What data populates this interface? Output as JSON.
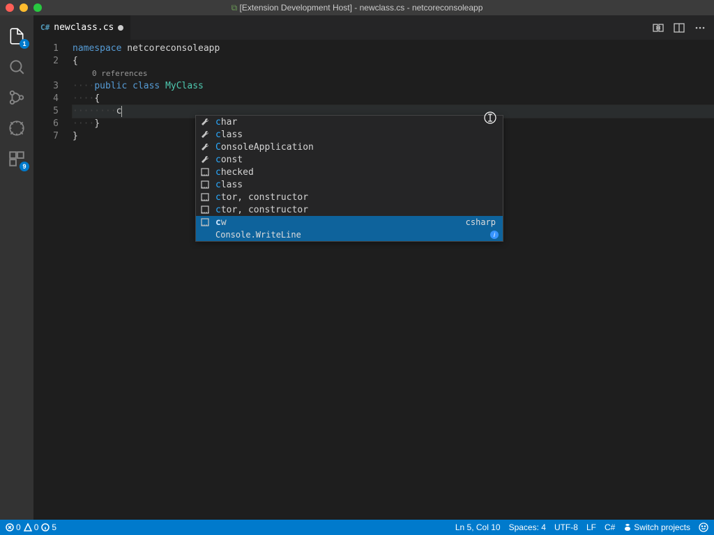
{
  "window": {
    "title": "[Extension Development Host] - newclass.cs - netcoreconsoleapp"
  },
  "activity": {
    "explorer_badge": "1",
    "extensions_badge": "9"
  },
  "tab": {
    "lang_tag": "C#",
    "filename": "newclass.cs"
  },
  "code": {
    "line1_kw1": "namespace",
    "line1_ident": "netcoreconsoleapp",
    "line2": "{",
    "codelens": "0 references",
    "line3_ws": "····",
    "line3_kw1": "public",
    "line3_kw2": "class",
    "line3_type": "MyClass",
    "line4_ws": "····",
    "line4": "{",
    "line5_ws": "········",
    "line5_input": "c",
    "line6_ws": "····",
    "line6": "}",
    "line7": "}",
    "line_numbers": [
      "1",
      "2",
      "3",
      "4",
      "5",
      "6",
      "7"
    ]
  },
  "suggest": {
    "items": [
      {
        "kind": "wrench",
        "prefix": "c",
        "rest": "har"
      },
      {
        "kind": "wrench",
        "prefix": "c",
        "rest": "lass"
      },
      {
        "kind": "wrench",
        "prefix": "C",
        "rest": "onsoleApplication"
      },
      {
        "kind": "wrench",
        "prefix": "c",
        "rest": "onst"
      },
      {
        "kind": "snippet",
        "prefix": "c",
        "rest": "hecked"
      },
      {
        "kind": "snippet",
        "prefix": "c",
        "rest": "lass"
      },
      {
        "kind": "snippet",
        "prefix": "c",
        "rest": "tor, constructor"
      },
      {
        "kind": "snippet",
        "prefix": "c",
        "rest": "tor, constructor"
      },
      {
        "kind": "snippet",
        "prefix": "c",
        "rest": "w",
        "tail": "csharp",
        "selected": true
      }
    ],
    "detail": "Console.WriteLine"
  },
  "status": {
    "errors": "0",
    "warnings": "0",
    "info": "5",
    "cursor": "Ln 5, Col 10",
    "spaces": "Spaces: 4",
    "encoding": "UTF-8",
    "eol": "LF",
    "lang": "C#",
    "projects": "Switch projects"
  }
}
